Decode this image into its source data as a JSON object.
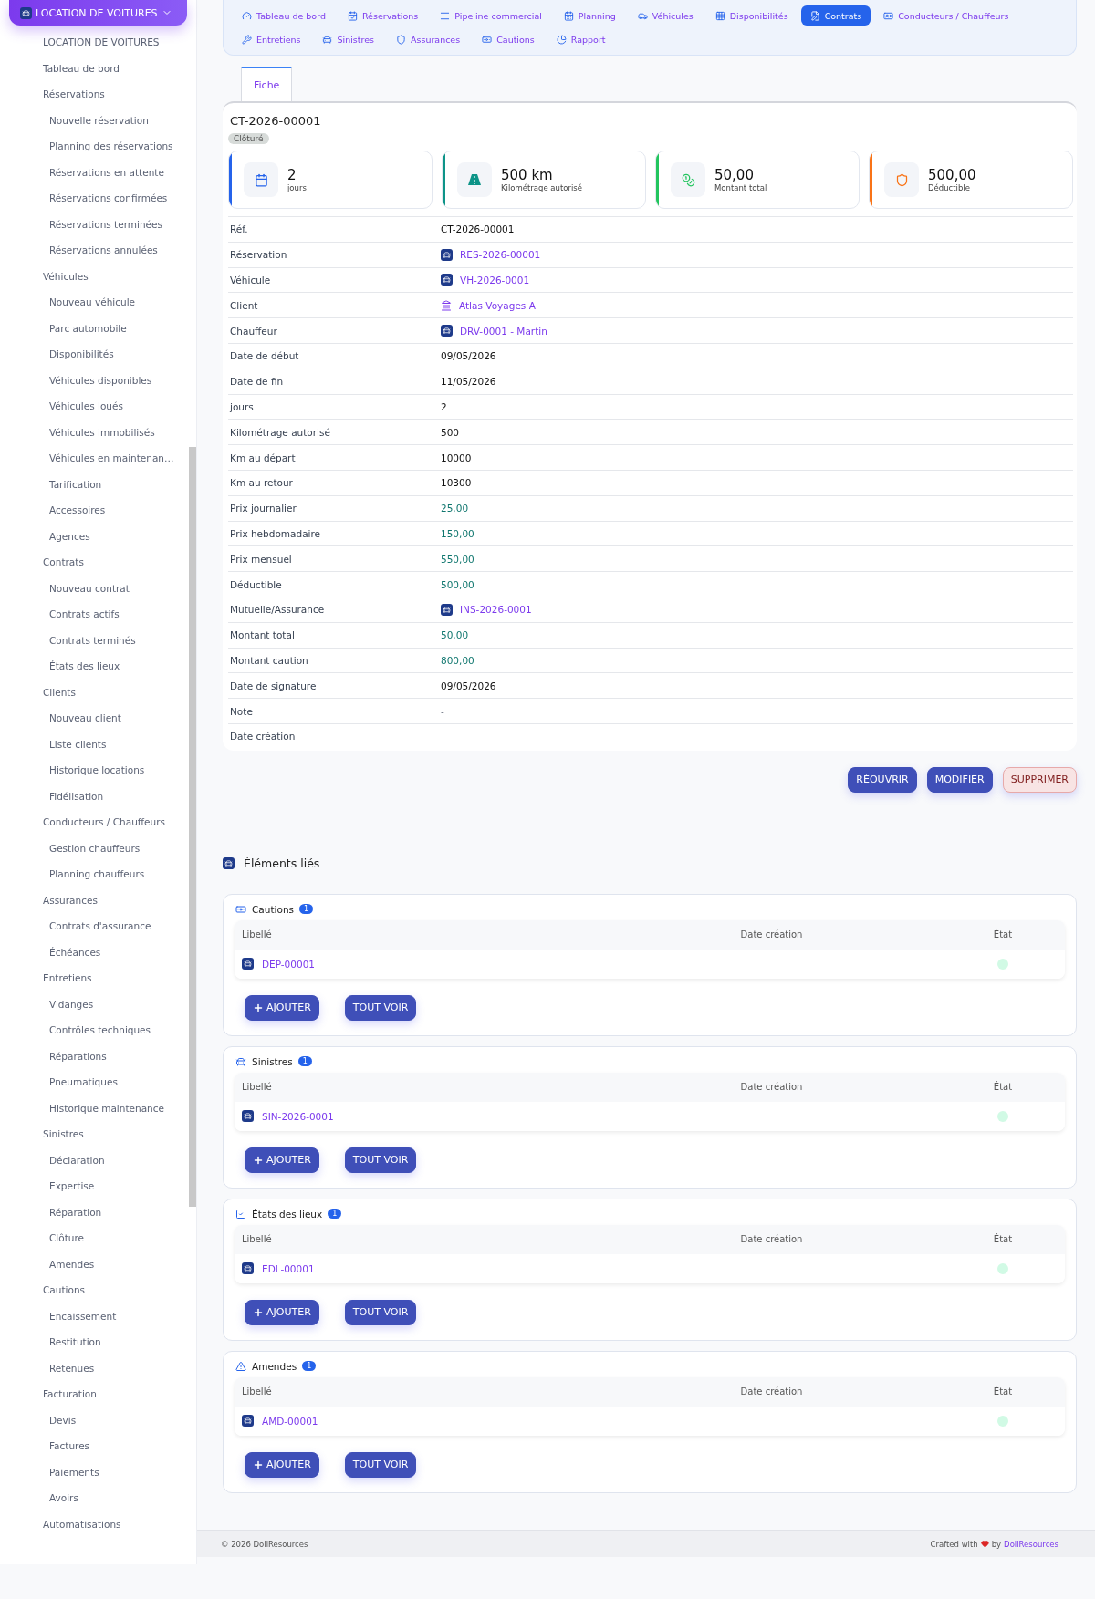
{
  "sidebar": {
    "module": "LOCATION DE VOITURES",
    "items": [
      {
        "label": "LOCATION DE VOITURES"
      },
      {
        "label": "Tableau de bord"
      },
      {
        "label": "Réservations",
        "children": [
          {
            "label": "Nouvelle réservation"
          },
          {
            "label": "Planning des réservations"
          },
          {
            "label": "Réservations en attente"
          },
          {
            "label": "Réservations confirmées"
          },
          {
            "label": "Réservations terminées"
          },
          {
            "label": "Réservations annulées"
          }
        ]
      },
      {
        "label": "Véhicules",
        "children": [
          {
            "label": "Nouveau véhicule"
          },
          {
            "label": "Parc automobile"
          },
          {
            "label": "Disponibilités"
          },
          {
            "label": "Véhicules disponibles"
          },
          {
            "label": "Véhicules loués"
          },
          {
            "label": "Véhicules immobilisés"
          },
          {
            "label": "Véhicules en maintenan…"
          },
          {
            "label": "Tarification"
          },
          {
            "label": "Accessoires"
          },
          {
            "label": "Agences"
          }
        ]
      },
      {
        "label": "Contrats",
        "children": [
          {
            "label": "Nouveau contrat"
          },
          {
            "label": "Contrats actifs"
          },
          {
            "label": "Contrats terminés"
          },
          {
            "label": "États des lieux"
          }
        ]
      },
      {
        "label": "Clients",
        "children": [
          {
            "label": "Nouveau client"
          },
          {
            "label": "Liste clients"
          },
          {
            "label": "Historique locations"
          },
          {
            "label": "Fidélisation"
          }
        ]
      },
      {
        "label": "Conducteurs / Chauffeurs",
        "children": [
          {
            "label": "Gestion chauffeurs"
          },
          {
            "label": "Planning chauffeurs"
          }
        ]
      },
      {
        "label": "Assurances",
        "children": [
          {
            "label": "Contrats d'assurance"
          },
          {
            "label": "Échéances"
          }
        ]
      },
      {
        "label": "Entretiens",
        "children": [
          {
            "label": "Vidanges"
          },
          {
            "label": "Contrôles techniques"
          },
          {
            "label": "Réparations"
          },
          {
            "label": "Pneumatiques"
          },
          {
            "label": "Historique maintenance"
          }
        ]
      },
      {
        "label": "Sinistres",
        "children": [
          {
            "label": "Déclaration"
          },
          {
            "label": "Expertise"
          },
          {
            "label": "Réparation"
          },
          {
            "label": "Clôture"
          },
          {
            "label": "Amendes"
          }
        ]
      },
      {
        "label": "Cautions",
        "children": [
          {
            "label": "Encaissement"
          },
          {
            "label": "Restitution"
          },
          {
            "label": "Retenues"
          }
        ]
      },
      {
        "label": "Facturation",
        "children": [
          {
            "label": "Devis"
          },
          {
            "label": "Factures"
          },
          {
            "label": "Paiements"
          },
          {
            "label": "Avoirs"
          }
        ]
      },
      {
        "label": "Automatisations"
      }
    ]
  },
  "nav": [
    {
      "label": "Tableau de bord",
      "selected": false
    },
    {
      "label": "Réservations",
      "selected": false
    },
    {
      "label": "Pipeline commercial",
      "selected": false
    },
    {
      "label": "Planning",
      "selected": false
    },
    {
      "label": "Véhicules",
      "selected": false
    },
    {
      "label": "Disponibilités",
      "selected": false
    },
    {
      "label": "Contrats",
      "selected": true
    },
    {
      "label": "Conducteurs / Chauffeurs",
      "selected": false
    },
    {
      "label": "Entretiens",
      "selected": false
    },
    {
      "label": "Sinistres",
      "selected": false
    },
    {
      "label": "Assurances",
      "selected": false
    },
    {
      "label": "Cautions",
      "selected": false
    },
    {
      "label": "Rapport",
      "selected": false
    }
  ],
  "tabs": [
    {
      "label": "Fiche",
      "selected": true
    }
  ],
  "record": {
    "ref": "CT-2026-00001",
    "status": "Clôturé"
  },
  "stats": [
    {
      "value": "2",
      "label": "jours",
      "color": "#2563eb"
    },
    {
      "value": "500 km",
      "label": "Kilométrage autorisé",
      "color": "#0d9488"
    },
    {
      "value": "50,00",
      "label": "Montant total",
      "color": "#22c55e"
    },
    {
      "value": "500,00",
      "label": "Déductible",
      "color": "#f97316"
    }
  ],
  "fields": [
    {
      "label": "Réf.",
      "value": "CT-2026-00001",
      "kind": "text"
    },
    {
      "label": "Réservation",
      "value": "RES-2026-00001",
      "kind": "link"
    },
    {
      "label": "Véhicule",
      "value": "VH-2026-0001",
      "kind": "link"
    },
    {
      "label": "Client",
      "value": "Atlas Voyages A",
      "kind": "org"
    },
    {
      "label": "Chauffeur",
      "value": "DRV-0001 - Martin",
      "kind": "link"
    },
    {
      "label": "Date de début",
      "value": "09/05/2026",
      "kind": "text"
    },
    {
      "label": "Date de fin",
      "value": "11/05/2026",
      "kind": "text"
    },
    {
      "label": "jours",
      "value": "2",
      "kind": "text"
    },
    {
      "label": "Kilométrage autorisé",
      "value": "500",
      "kind": "text"
    },
    {
      "label": "Km au départ",
      "value": "10000",
      "kind": "text"
    },
    {
      "label": "Km au retour",
      "value": "10300",
      "kind": "text"
    },
    {
      "label": "Prix journalier",
      "value": "25,00",
      "kind": "amount"
    },
    {
      "label": "Prix hebdomadaire",
      "value": "150,00",
      "kind": "amount"
    },
    {
      "label": "Prix mensuel",
      "value": "550,00",
      "kind": "amount"
    },
    {
      "label": "Déductible",
      "value": "500,00",
      "kind": "amount"
    },
    {
      "label": "Mutuelle/Assurance",
      "value": "INS-2026-0001",
      "kind": "link"
    },
    {
      "label": "Montant total",
      "value": "50,00",
      "kind": "amount"
    },
    {
      "label": "Montant caution",
      "value": "800,00",
      "kind": "amount"
    },
    {
      "label": "Date de signature",
      "value": "09/05/2026",
      "kind": "text"
    },
    {
      "label": "Note",
      "value": "-",
      "kind": "muted"
    },
    {
      "label": "Date création"
    }
  ],
  "actions": [
    {
      "label": "RÉOUVRIR",
      "kind": "primary"
    },
    {
      "label": "MODIFIER",
      "kind": "primary"
    },
    {
      "label": "SUPPRIMER",
      "kind": "danger"
    }
  ],
  "linked": {
    "title": "Éléments liés",
    "sections": [
      {
        "title": "Cautions",
        "count": "1",
        "columns": [
          "Libellé",
          "Date création",
          "État"
        ],
        "rows": [
          {
            "ref": "DEP-00001",
            "color": "#d1fae5"
          }
        ],
        "add": "AJOUTER",
        "all": "TOUT VOIR"
      },
      {
        "title": "Sinistres",
        "count": "1",
        "columns": [
          "Libellé",
          "Date création",
          "État"
        ],
        "rows": [
          {
            "ref": "SIN-2026-0001",
            "color": "#d1fae5"
          }
        ],
        "add": "AJOUTER",
        "all": "TOUT VOIR"
      },
      {
        "title": "États des lieux",
        "count": "1",
        "columns": [
          "Libellé",
          "Date création",
          "État"
        ],
        "rows": [
          {
            "ref": "EDL-00001",
            "color": "#d1fae5"
          }
        ],
        "add": "AJOUTER",
        "all": "TOUT VOIR"
      },
      {
        "title": "Amendes",
        "count": "1",
        "columns": [
          "Libellé",
          "Date création",
          "État"
        ],
        "rows": [
          {
            "ref": "AMD-00001",
            "color": "#d1fae5"
          }
        ],
        "add": "AJOUTER",
        "all": "TOUT VOIR"
      }
    ]
  },
  "footer": {
    "copyright": "© 2026 DoliResources",
    "crafted": "Crafted with",
    "by": "by",
    "brand": "DoliResources"
  }
}
